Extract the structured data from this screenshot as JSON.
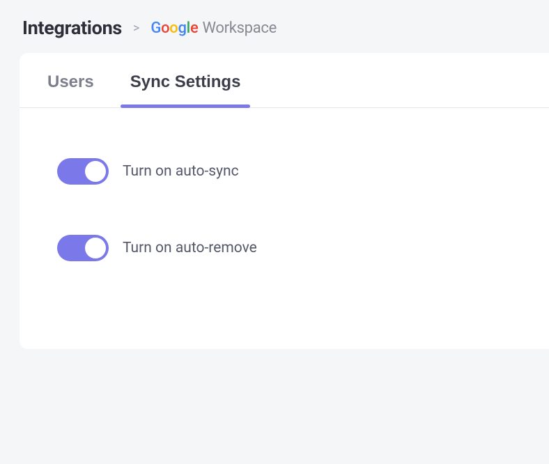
{
  "breadcrumb": {
    "title": "Integrations",
    "separator": ">",
    "google": {
      "g1": "G",
      "o1": "o",
      "o2": "o",
      "g2": "g",
      "l": "l",
      "e": "e",
      "workspace": "Workspace"
    }
  },
  "tabs": {
    "users": "Users",
    "sync_settings": "Sync Settings"
  },
  "settings": {
    "auto_sync": {
      "label": "Turn on auto-sync",
      "enabled": true
    },
    "auto_remove": {
      "label": "Turn on auto-remove",
      "enabled": true
    }
  }
}
